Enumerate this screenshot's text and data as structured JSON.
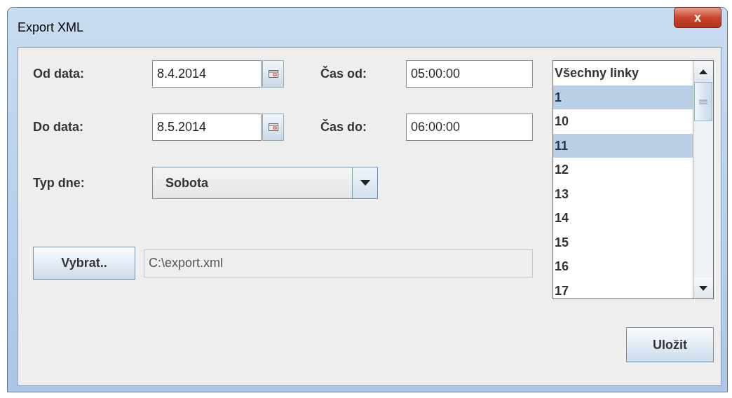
{
  "window": {
    "title": "Export XML",
    "close": "x"
  },
  "fields": [
    {
      "label": "Od data:",
      "date": "8.4.2014",
      "time_label": "Čas od:",
      "time": "05:00:00"
    },
    {
      "label": "Do data:",
      "date": "8.5.2014",
      "time_label": "Čas do:",
      "time": "06:00:00"
    }
  ],
  "day_type": {
    "label": "Typ dne:",
    "value": "Sobota"
  },
  "file": {
    "button": "Vybrat..",
    "path": "C:\\export.xml"
  },
  "lines": [
    {
      "label": "Všechny linky",
      "selected": false
    },
    {
      "label": "1",
      "selected": true
    },
    {
      "label": "10",
      "selected": false
    },
    {
      "label": "11",
      "selected": true
    },
    {
      "label": "12",
      "selected": false
    },
    {
      "label": "13",
      "selected": false
    },
    {
      "label": "14",
      "selected": false
    },
    {
      "label": "15",
      "selected": false
    },
    {
      "label": "16",
      "selected": false
    },
    {
      "label": "17",
      "selected": false
    }
  ],
  "save_button": "Uložit"
}
